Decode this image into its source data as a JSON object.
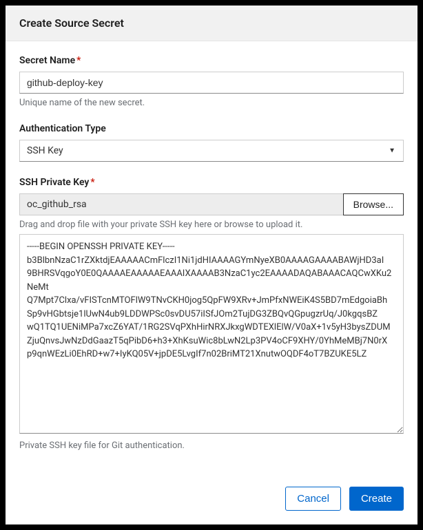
{
  "modal": {
    "title": "Create Source Secret"
  },
  "secretName": {
    "label": "Secret Name",
    "value": "github-deploy-key",
    "help": "Unique name of the new secret."
  },
  "authType": {
    "label": "Authentication Type",
    "value": "SSH Key"
  },
  "sshKey": {
    "label": "SSH Private Key",
    "fileName": "oc_github_rsa",
    "browseLabel": "Browse...",
    "fileHelp": "Drag and drop file with your private SSH key here or browse to upload it.",
    "value": "-----BEGIN OPENSSH PRIVATE KEY-----\nb3BlbnNzaC1rZXktdjEAAAAACmFlczI1Ni1jdHIAAAAGYmNyeXB0AAAAGAAAABAWjHD3aI\n9BHRSVqgoY0E0QAAAAEAAAAAEAAAIXAAAAB3NzaC1yc2EAAAADAQABAAACAQCwXKu2NeMt\nQ7Mpt7Clxa/vFISTcnMTOFlW9TNvCKH0jog5QpFW9XRv+JmPfxNWEiK4S5BD7mEdgoiaBh\nSp9vHGbtsje1lUwN4ub9LDDWPSc0svDU57iISfJOm2TujDG3ZBQvQGpugzrUq/J0kgqsBZ\nwQ1TQ1UENiMPa7xcZ6YAT/1RG2SVqPXhHirNRXJkxgWDTEXlElW/V0aX+1v5yH3bysZDUM\nZjuQnvsJwNzDdGaazT5qPibD6+h3+XhKsuWic8bLwN2Lp3PV4oCF9XHY/0YhMeMBj7N0rX\np9qnWEzLi0EhRD+w7+IyKQ05V+jpDE5LvgIf7n02BriMT21XnutwOQDF4oT7BZUKE5LZ",
    "help": "Private SSH key file for Git authentication."
  },
  "footer": {
    "cancelLabel": "Cancel",
    "createLabel": "Create"
  }
}
